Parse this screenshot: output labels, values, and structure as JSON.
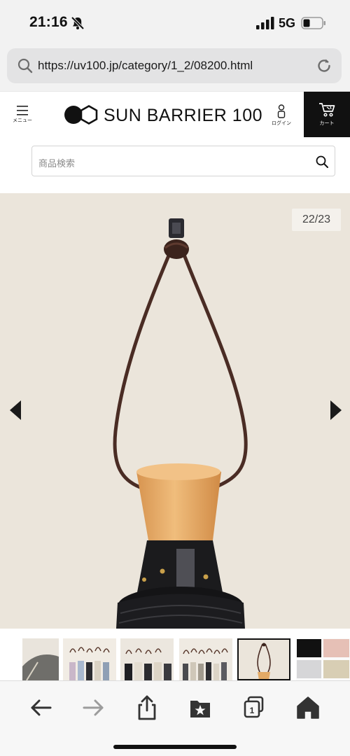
{
  "status_bar": {
    "time": "21:16",
    "network": "5G"
  },
  "browser": {
    "url": "https://uv100.jp/category/1_2/08200.html"
  },
  "header": {
    "menu_label": "メニュー",
    "logo_text": "SUN BARRIER 100",
    "login_label": "ログイン",
    "cart_label": "カート"
  },
  "search": {
    "placeholder": "商品検索"
  },
  "gallery": {
    "counter": "22/23"
  },
  "thumbnails": [
    "umbrella-grey",
    "umbrellas-hanging-light",
    "umbrellas-hanging-dark",
    "umbrellas-hanging-mixed",
    "handle-loop-selected",
    "color-swatches"
  ],
  "colors": {
    "cart_bg": "#111111",
    "gallery_bg": "#ebe5db",
    "strap": "#4a2c24",
    "wood_handle": "#e3aa66"
  }
}
